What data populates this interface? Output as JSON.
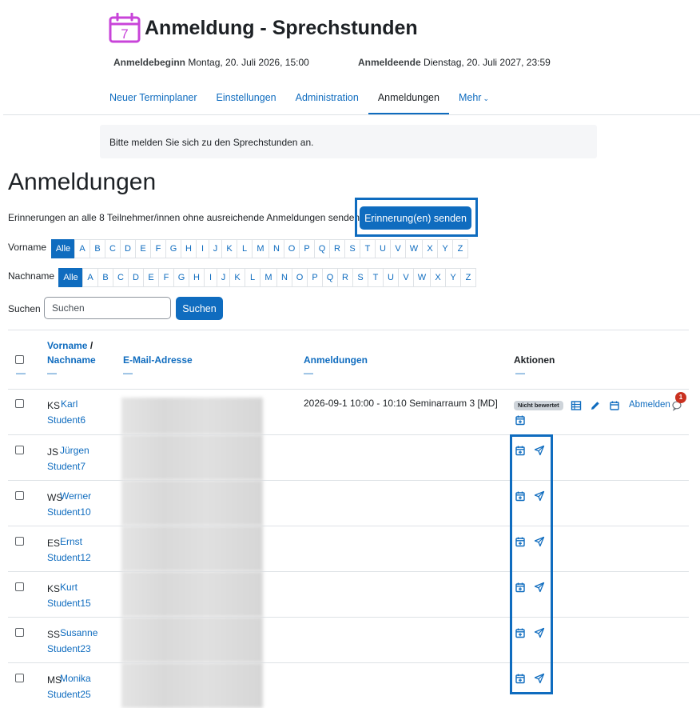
{
  "page": {
    "title": "Anmeldung - Sprechstunden",
    "calendar_day": "7",
    "icon_color": "#c844d9"
  },
  "dates": {
    "start_label": "Anmeldebeginn",
    "start_value": "Montag, 20. Juli 2026, 15:00",
    "end_label": "Anmeldeende",
    "end_value": "Dienstag, 20. Juli 2027, 23:59"
  },
  "tabs": [
    {
      "label": "Neuer Terminplaner"
    },
    {
      "label": "Einstellungen"
    },
    {
      "label": "Administration"
    },
    {
      "label": "Anmeldungen",
      "active": true
    },
    {
      "label": "Mehr",
      "dropdown_icon": "chevron-down-icon"
    }
  ],
  "notice": "Bitte melden Sie sich zu den Sprechstunden an.",
  "section_title": "Anmeldungen",
  "reminder": {
    "text": "Erinnerungen an alle 8 Teilnehmer/innen ohne ausreichende Anmeldungen senden",
    "button": "Erinnerung(en) senden"
  },
  "filters": {
    "firstname_label": "Vorname",
    "lastname_label": "Nachname",
    "all_label": "Alle",
    "letters": [
      "A",
      "B",
      "C",
      "D",
      "E",
      "F",
      "G",
      "H",
      "I",
      "J",
      "K",
      "L",
      "M",
      "N",
      "O",
      "P",
      "Q",
      "R",
      "S",
      "T",
      "U",
      "V",
      "W",
      "X",
      "Y",
      "Z"
    ]
  },
  "search": {
    "label": "Suchen",
    "placeholder": "Suchen",
    "button": "Suchen"
  },
  "table": {
    "headers": {
      "firstname": "Vorname",
      "separator": "/",
      "lastname": "Nachname",
      "email": "E-Mail-Adresse",
      "bookings": "Anmeldungen",
      "actions": "Aktionen",
      "dash": "—"
    },
    "rows": [
      {
        "initials": "KS",
        "firstname": "Karl",
        "lastname": "Student6",
        "booking": "2026-09-1   10:00 - 10:10 Seminarraum 3 [MD]",
        "grade_badge": "Nicht bewertet",
        "cancel_label": "Abmelden",
        "notification_count": "1",
        "icons": [
          "list-icon",
          "pencil-icon",
          "calendar-icon",
          "calendar-plus-icon",
          "comment-icon"
        ]
      },
      {
        "initials": "JS",
        "firstname": "Jürgen",
        "lastname": "Student7",
        "icons": [
          "calendar-plus-icon",
          "send-icon"
        ]
      },
      {
        "initials": "WS",
        "firstname": "Werner",
        "lastname": "Student10",
        "icons": [
          "calendar-plus-icon",
          "send-icon"
        ]
      },
      {
        "initials": "ES",
        "firstname": "Ernst",
        "lastname": "Student12",
        "icons": [
          "calendar-plus-icon",
          "send-icon"
        ]
      },
      {
        "initials": "KS",
        "firstname": "Kurt",
        "lastname": "Student15",
        "icons": [
          "calendar-plus-icon",
          "send-icon"
        ]
      },
      {
        "initials": "SS",
        "firstname": "Susanne",
        "lastname": "Student23",
        "icons": [
          "calendar-plus-icon",
          "send-icon"
        ]
      },
      {
        "initials": "MS",
        "firstname": "Monika",
        "lastname": "Student25",
        "icons": [
          "calendar-plus-icon",
          "send-icon"
        ]
      }
    ]
  },
  "colors": {
    "link": "#0f6cbf",
    "primary": "#0f6cbf",
    "badge_red": "#ca3120"
  }
}
